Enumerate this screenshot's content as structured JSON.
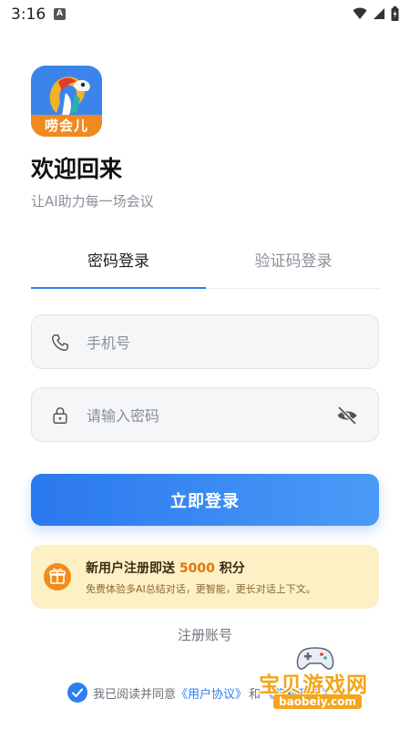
{
  "status_bar": {
    "time": "3:16",
    "notif": "A"
  },
  "app": {
    "logo_text": "唠会儿"
  },
  "welcome": {
    "title": "欢迎回来",
    "subtitle": "让AI助力每一场会议"
  },
  "tabs": [
    {
      "label": "密码登录",
      "active": true
    },
    {
      "label": "验证码登录",
      "active": false
    }
  ],
  "form": {
    "phone_placeholder": "手机号",
    "phone_value": "",
    "password_placeholder": "请输入密码",
    "password_value": ""
  },
  "login_button": "立即登录",
  "promo": {
    "title_prefix": "新用户注册即送 ",
    "points": "5000",
    "title_suffix": " 积分",
    "description": "免费体验多AI总结对话，更智能，更长对话上下文。"
  },
  "register_link": "注册账号",
  "agreement": {
    "checked": true,
    "prefix": "我已阅读并同意",
    "user_agreement": "《用户协议》",
    "and": "和",
    "privacy_policy": "《隐私政策》"
  },
  "watermark": {
    "title": "宝贝游戏网",
    "url": "baobeiy.com"
  },
  "colors": {
    "accent": "#2e7ef0",
    "promo_bg": "#fdf0c4",
    "logo_bg": "#3b85ea",
    "logo_band": "#f08a1f"
  }
}
